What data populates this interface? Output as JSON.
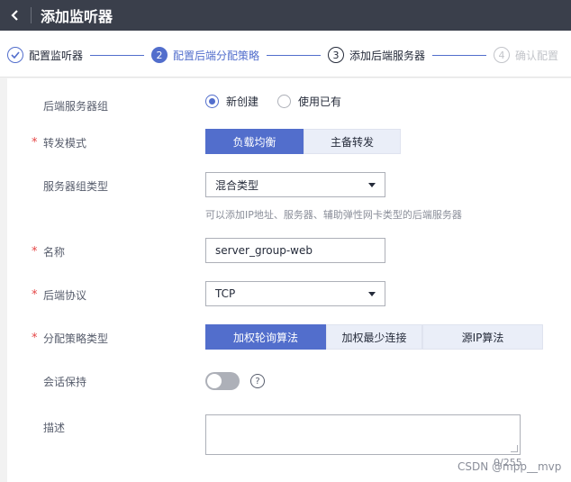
{
  "header": {
    "title": "添加监听器"
  },
  "steps": [
    {
      "num": "✓",
      "label": "配置监听器"
    },
    {
      "num": "2",
      "label": "配置后端分配策略"
    },
    {
      "num": "3",
      "label": "添加后端服务器"
    },
    {
      "num": "4",
      "label": "确认配置"
    }
  ],
  "form": {
    "backend_group": {
      "label": "后端服务器组",
      "options": [
        "新创建",
        "使用已有"
      ],
      "selected": "新创建"
    },
    "forward_mode": {
      "label": "转发模式",
      "options": [
        "负载均衡",
        "主备转发"
      ],
      "selected": "负载均衡"
    },
    "group_type": {
      "label": "服务器组类型",
      "value": "混合类型",
      "hint": "可以添加IP地址、服务器、辅助弹性网卡类型的后端服务器"
    },
    "name": {
      "label": "名称",
      "value": "server_group-web"
    },
    "protocol": {
      "label": "后端协议",
      "value": "TCP"
    },
    "algorithm": {
      "label": "分配策略类型",
      "options": [
        "加权轮询算法",
        "加权最少连接",
        "源IP算法"
      ],
      "selected": "加权轮询算法"
    },
    "session": {
      "label": "会话保持",
      "help": "?",
      "enabled": false
    },
    "description": {
      "label": "描述",
      "counter": "0/255"
    }
  },
  "watermark": "CSDN @mpp__mvp",
  "colors": {
    "accent": "#526ecc",
    "header_bg": "#3a3f4b",
    "required": "#e54545"
  }
}
